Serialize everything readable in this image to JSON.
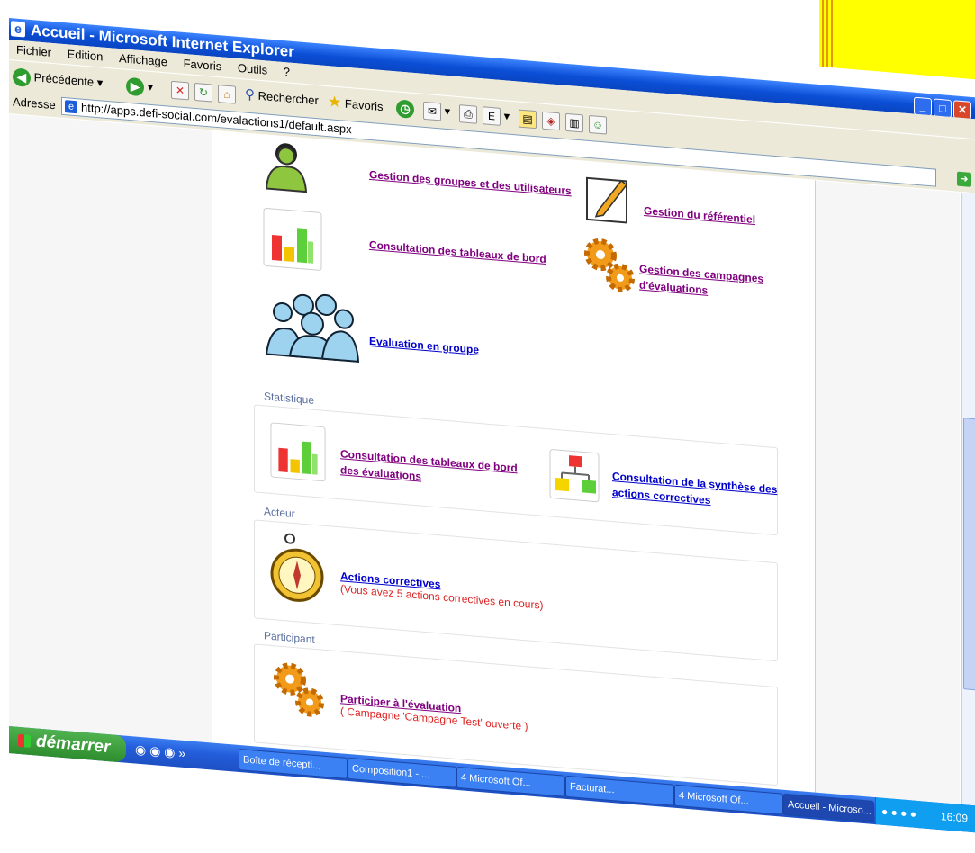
{
  "window": {
    "title": "Accueil - Microsoft Internet Explorer"
  },
  "menu": [
    "Fichier",
    "Edition",
    "Affichage",
    "Favoris",
    "Outils",
    "?"
  ],
  "toolbar": {
    "back_label": "Précédente",
    "search_label": "Rechercher",
    "favorites_label": "Favoris"
  },
  "address": {
    "label": "Adresse",
    "url": "http://apps.defi-social.com/evalactions1/default.aspx"
  },
  "admin": {
    "items": [
      {
        "label": "Gestion des groupes et des utilisateurs",
        "icon": "user-icon"
      },
      {
        "label": "Gestion du référentiel",
        "icon": "pencil-note-icon"
      },
      {
        "label": "Consultation des tableaux de bord",
        "icon": "bar-chart-icon"
      },
      {
        "label": "Gestion des campagnes d'évaluations",
        "icon": "gears-icon"
      },
      {
        "label": "Evaluation en groupe",
        "icon": "group-people-icon"
      }
    ]
  },
  "stats": {
    "title": "Statistique",
    "items": [
      {
        "label": "Consultation des tableaux de bord des évaluations",
        "icon": "bar-chart-icon"
      },
      {
        "label": "Consultation de la synthèse des actions correctives",
        "icon": "org-chart-icon"
      }
    ]
  },
  "acteur": {
    "title": "Acteur",
    "link": "Actions correctives",
    "note": "(Vous avez 5 actions correctives en cours)",
    "icon": "compass-icon"
  },
  "participant": {
    "title": "Participant",
    "link": "Participer à l'évaluation",
    "note": "( Campagne 'Campagne Test' ouverte )",
    "icon": "gears-icon"
  },
  "taskbar": {
    "start_label": "démarrer",
    "tasks": [
      "Boîte de récepti...",
      "Composition1 - ...",
      "4 Microsoft Of...",
      "Facturat...",
      "4 Microsoft Of...",
      "Accueil - Microso..."
    ],
    "clock": "16:09"
  },
  "colors": {
    "accent_yellow": "#ffff00",
    "link_purple": "#800080",
    "note_red": "#dd2222"
  }
}
